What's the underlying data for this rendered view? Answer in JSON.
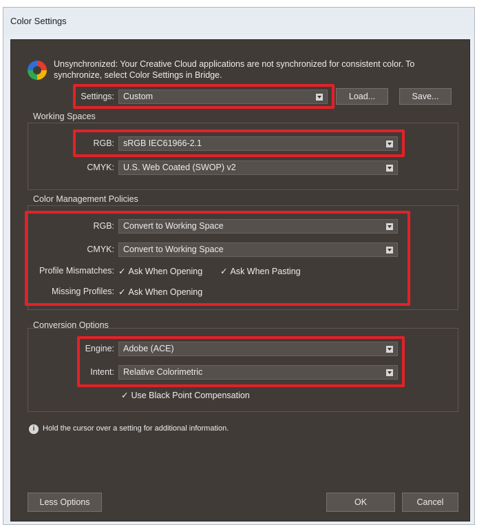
{
  "window": {
    "title": "Color Settings"
  },
  "sync_notice": {
    "line1": "Unsynchronized: Your Creative Cloud applications are not synchronized for consistent color. To",
    "line2": "synchronize, select Color Settings in Bridge."
  },
  "settings": {
    "label": "Settings:",
    "value": "Custom",
    "load_label": "Load...",
    "save_label": "Save..."
  },
  "working_spaces": {
    "title": "Working Spaces",
    "rgb": {
      "label": "RGB:",
      "value": "sRGB IEC61966-2.1"
    },
    "cmyk": {
      "label": "CMYK:",
      "value": "U.S. Web Coated (SWOP) v2"
    }
  },
  "policies": {
    "title": "Color Management Policies",
    "rgb": {
      "label": "RGB:",
      "value": "Convert to Working Space"
    },
    "cmyk": {
      "label": "CMYK:",
      "value": "Convert to Working Space"
    },
    "mismatch": {
      "label": "Profile Mismatches:",
      "ask_opening": "Ask When Opening",
      "ask_pasting": "Ask When Pasting"
    },
    "missing": {
      "label": "Missing Profiles:",
      "ask_opening": "Ask When Opening"
    },
    "check_glyph": "✓"
  },
  "conversion": {
    "title": "Conversion Options",
    "engine": {
      "label": "Engine:",
      "value": "Adobe (ACE)"
    },
    "intent": {
      "label": "Intent:",
      "value": "Relative Colorimetric"
    },
    "bpc_label": "Use Black Point Compensation"
  },
  "info": {
    "icon": "info-icon",
    "text": "Hold the cursor over a setting for additional information."
  },
  "buttons": {
    "less_options": "Less Options",
    "ok": "OK",
    "cancel": "Cancel"
  },
  "colors": {
    "highlight": "#e32128",
    "panel_bg": "#413b37"
  }
}
